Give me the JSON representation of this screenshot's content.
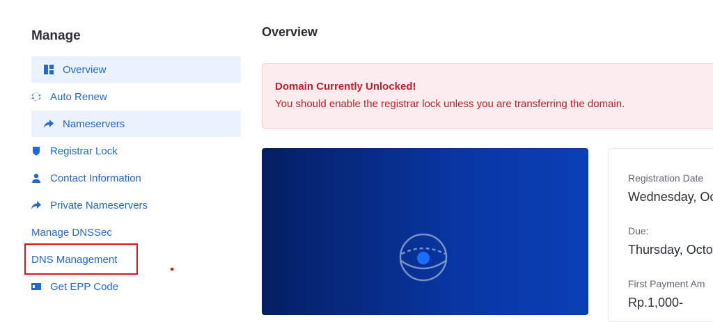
{
  "sidebar": {
    "title": "Manage",
    "items": [
      {
        "label": "Overview",
        "icon": "dashboard-icon"
      },
      {
        "label": "Auto Renew",
        "icon": "sync-icon"
      },
      {
        "label": "Nameservers",
        "icon": "share-arrow-icon"
      },
      {
        "label": "Registrar Lock",
        "icon": "shield-icon"
      },
      {
        "label": "Contact Information",
        "icon": "user-icon"
      },
      {
        "label": "Private Nameservers",
        "icon": "share-arrow-icon"
      },
      {
        "label": "Manage DNSSec"
      },
      {
        "label": "DNS Management"
      },
      {
        "label": "Get EPP Code",
        "icon": "id-card-icon"
      }
    ]
  },
  "main": {
    "title": "Overview",
    "alert": {
      "title": "Domain Currently Unlocked!",
      "message": "You should enable the registrar lock unless you are transferring the domain."
    },
    "info": {
      "registration_label": "Registration Date",
      "registration_value": "Wednesday, Oc",
      "due_label": "Due:",
      "due_value": "Thursday, Octo",
      "first_payment_label": "First Payment Am",
      "first_payment_value": "Rp.1,000-"
    }
  },
  "colors": {
    "accent": "#2168d8",
    "active_bg": "#eaf2fd",
    "alert_bg": "#fdeced",
    "alert_text": "#c0202b",
    "highlight": "#e5101f",
    "hero_dark": "#041f62",
    "hero_light": "#0b3fb6"
  }
}
